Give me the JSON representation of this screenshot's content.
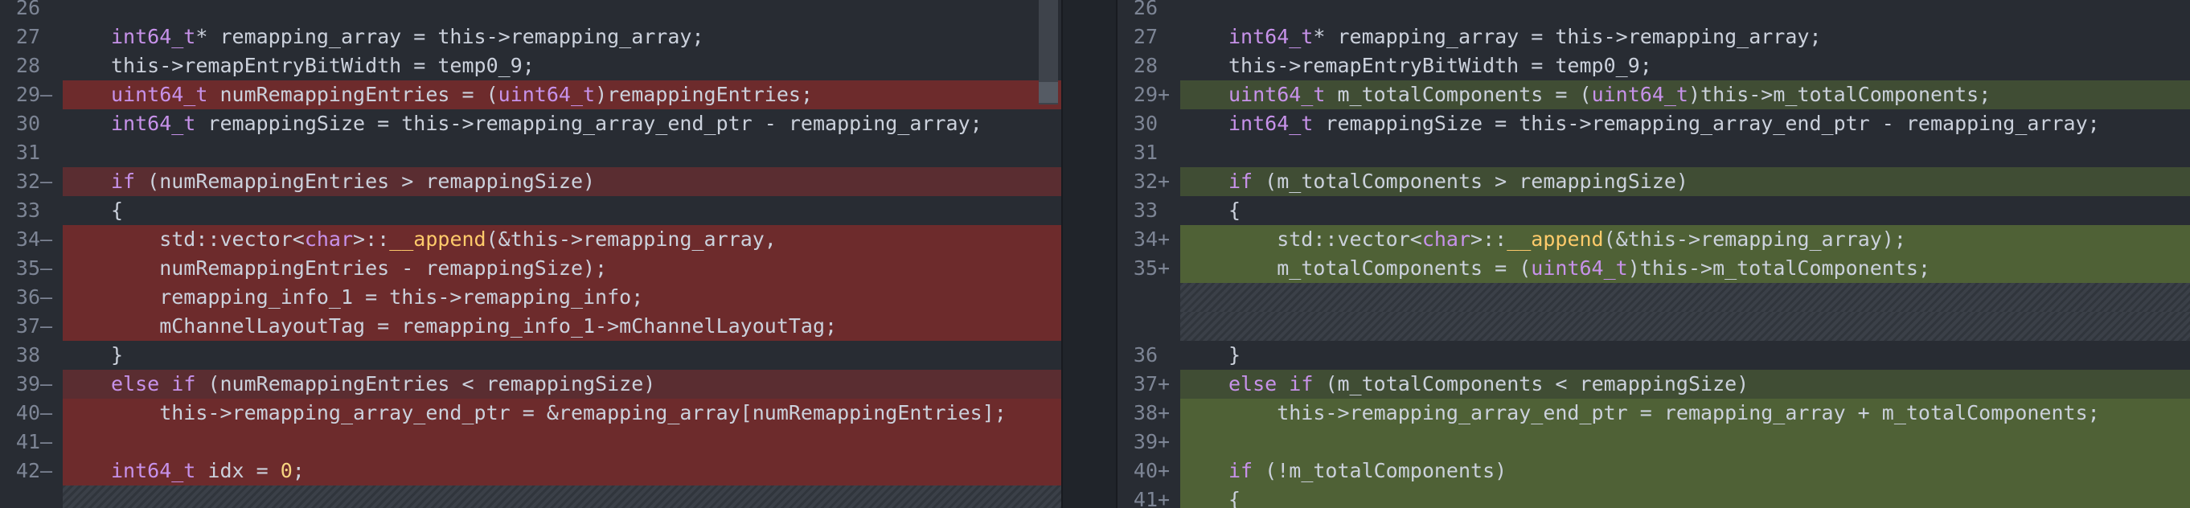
{
  "left": {
    "lines": [
      {
        "num": "26",
        "marker": "",
        "type": "ctx",
        "code": ""
      },
      {
        "num": "27",
        "marker": "",
        "type": "ctx",
        "code": "int64_t* remapping_array = this->remapping_array;"
      },
      {
        "num": "28",
        "marker": "",
        "type": "ctx",
        "code": "this->remapEntryBitWidth = temp0_9;"
      },
      {
        "num": "29",
        "marker": "—",
        "type": "del",
        "code": "uint64_t numRemappingEntries = (uint64_t)remappingEntries;"
      },
      {
        "num": "30",
        "marker": "",
        "type": "ctx",
        "code": "int64_t remappingSize = this->remapping_array_end_ptr - remapping_array;"
      },
      {
        "num": "31",
        "marker": "",
        "type": "ctx",
        "code": ""
      },
      {
        "num": "32",
        "marker": "—",
        "type": "del2",
        "code": "if (numRemappingEntries > remappingSize)"
      },
      {
        "num": "33",
        "marker": "",
        "type": "ctx",
        "code": "{"
      },
      {
        "num": "34",
        "marker": "—",
        "type": "del",
        "code": "    std::vector<char>::__append(&this->remapping_array,"
      },
      {
        "num": "35",
        "marker": "—",
        "type": "del",
        "code": "    numRemappingEntries - remappingSize);"
      },
      {
        "num": "36",
        "marker": "—",
        "type": "del",
        "code": "    remapping_info_1 = this->remapping_info;"
      },
      {
        "num": "37",
        "marker": "—",
        "type": "del",
        "code": "    mChannelLayoutTag = remapping_info_1->mChannelLayoutTag;"
      },
      {
        "num": "38",
        "marker": "",
        "type": "ctx",
        "code": "}"
      },
      {
        "num": "39",
        "marker": "—",
        "type": "del2",
        "code": "else if (numRemappingEntries < remappingSize)"
      },
      {
        "num": "40",
        "marker": "—",
        "type": "del",
        "code": "    this->remapping_array_end_ptr = &remapping_array[numRemappingEntries];"
      },
      {
        "num": "41",
        "marker": "—",
        "type": "del",
        "code": ""
      },
      {
        "num": "42",
        "marker": "—",
        "type": "del",
        "code": "int64_t idx = 0;"
      },
      {
        "num": "",
        "marker": "",
        "type": "hatch",
        "code": ""
      }
    ]
  },
  "right": {
    "lines": [
      {
        "num": "26",
        "marker": "",
        "type": "ctx",
        "code": ""
      },
      {
        "num": "27",
        "marker": "",
        "type": "ctx",
        "code": "int64_t* remapping_array = this->remapping_array;"
      },
      {
        "num": "28",
        "marker": "",
        "type": "ctx",
        "code": "this->remapEntryBitWidth = temp0_9;"
      },
      {
        "num": "29",
        "marker": "+",
        "type": "add2",
        "code": "uint64_t m_totalComponents = (uint64_t)this->m_totalComponents;"
      },
      {
        "num": "30",
        "marker": "",
        "type": "ctx",
        "code": "int64_t remappingSize = this->remapping_array_end_ptr - remapping_array;"
      },
      {
        "num": "31",
        "marker": "",
        "type": "ctx",
        "code": ""
      },
      {
        "num": "32",
        "marker": "+",
        "type": "add2",
        "code": "if (m_totalComponents > remappingSize)"
      },
      {
        "num": "33",
        "marker": "",
        "type": "ctx",
        "code": "{"
      },
      {
        "num": "34",
        "marker": "+",
        "type": "add",
        "code": "    std::vector<char>::__append(&this->remapping_array);"
      },
      {
        "num": "35",
        "marker": "+",
        "type": "add",
        "code": "    m_totalComponents = (uint64_t)this->m_totalComponents;"
      },
      {
        "num": "",
        "marker": "",
        "type": "hatch",
        "code": ""
      },
      {
        "num": "",
        "marker": "",
        "type": "hatch",
        "code": ""
      },
      {
        "num": "36",
        "marker": "",
        "type": "ctx",
        "code": "}"
      },
      {
        "num": "37",
        "marker": "+",
        "type": "add2",
        "code": "else if (m_totalComponents < remappingSize)"
      },
      {
        "num": "38",
        "marker": "+",
        "type": "add",
        "code": "    this->remapping_array_end_ptr = remapping_array + m_totalComponents;"
      },
      {
        "num": "39",
        "marker": "+",
        "type": "add",
        "code": ""
      },
      {
        "num": "40",
        "marker": "+",
        "type": "add",
        "code": "if (!m_totalComponents)"
      },
      {
        "num": "41",
        "marker": "+",
        "type": "add",
        "code": "{"
      }
    ]
  }
}
